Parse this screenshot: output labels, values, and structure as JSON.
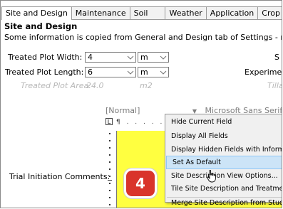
{
  "tabs": [
    "Site and Design",
    "Maintenance",
    "Soil",
    "Weather",
    "Application",
    "Crop Stage at Appl."
  ],
  "section": {
    "title": "Site and Design",
    "info": "Some information is copied from General and Design tab of Settings - make changes th"
  },
  "fields": {
    "treated_plot_width": {
      "label": "Treated Plot Width:",
      "value": "4",
      "unit": "m"
    },
    "treated_plot_length": {
      "label": "Treated Plot Length:",
      "value": "6",
      "unit": "m"
    },
    "treated_plot_area": {
      "label": "Treated Plot Area:",
      "value": "24.0",
      "unit": "m2"
    },
    "right_label_1": "S",
    "right_label_2": "Experimen",
    "right_label_3": "Tilla"
  },
  "editor": {
    "style_value": "[Normal]",
    "font_value": "Microsoft Sans Serif",
    "ruler_marker": "L",
    "ruler_text": "¶ . . . . . ."
  },
  "trial_initiation_label": "Trial Initiation Comments:",
  "step_badge": "4",
  "context_menu": {
    "items": [
      "Hide Current Field",
      "Display All Fields",
      "Display Hidden Fields with Information",
      "Set As Default",
      "Site Description View Options...",
      "Tile Site Description and Treatment Editors",
      "Merge Site Description from Study..."
    ],
    "highlighted": "Set As Default"
  },
  "colors": {
    "highlight": "#cce4f7",
    "editor_bg": "#ffff40",
    "badge": "#d9342b"
  }
}
